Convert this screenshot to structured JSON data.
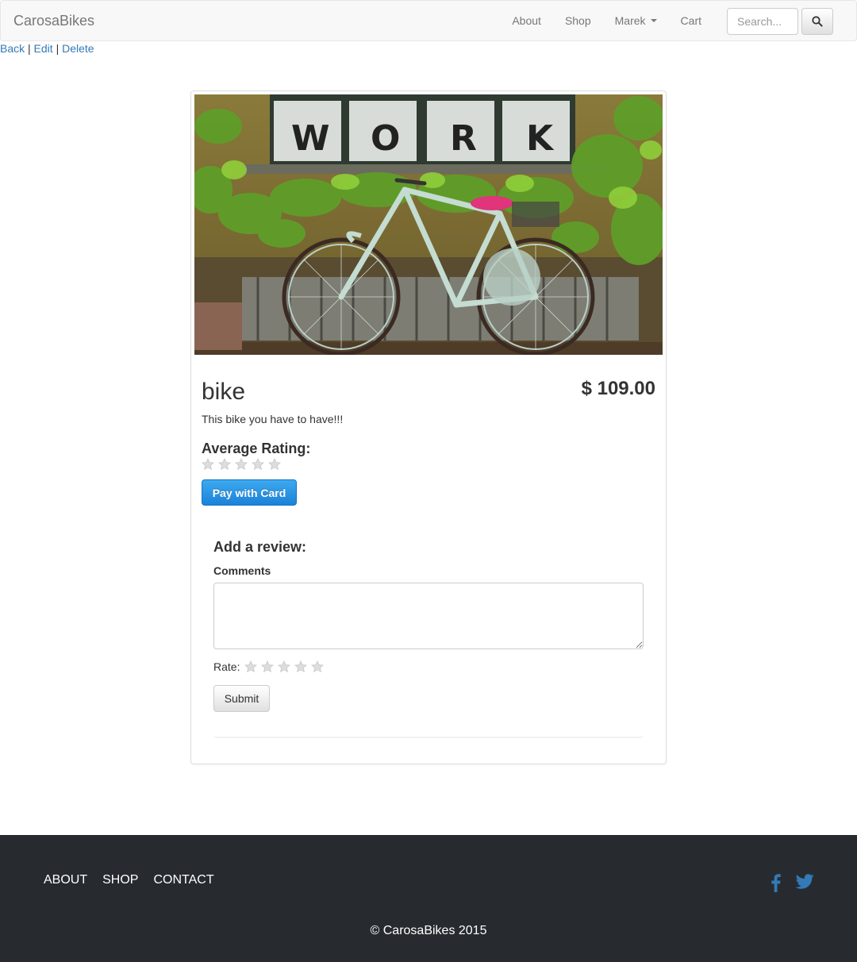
{
  "navbar": {
    "brand": "CarosaBikes",
    "links": {
      "about": "About",
      "shop": "Shop",
      "user": "Marek",
      "cart": "Cart"
    },
    "search_placeholder": "Search...",
    "search_icon": "search-icon"
  },
  "admin_links": {
    "back": "Back",
    "separator": "|",
    "edit": "Edit",
    "delete": "Delete"
  },
  "product": {
    "image_sign": "W O R K",
    "name": "bike",
    "price": "$ 109.00",
    "description": "This bike you have to have!!!",
    "average_rating_label": "Average Rating:",
    "average_rating": 0,
    "max_rating": 5,
    "pay_button": "Pay with Card"
  },
  "review_form": {
    "title": "Add a review:",
    "comments_label": "Comments",
    "comments_value": "",
    "rate_label": "Rate:",
    "rate_value": 0,
    "submit_label": "Submit"
  },
  "footer": {
    "links": {
      "about": "ABOUT",
      "shop": "SHOP",
      "contact": "CONTACT"
    },
    "social_icons": [
      "facebook-icon",
      "twitter-icon"
    ],
    "copyright": "© CarosaBikes 2015"
  },
  "colors": {
    "link": "#337ab7",
    "pay_button": "#1b82d8",
    "footer_bg": "#272b30",
    "social": "#337ab7",
    "star_empty": "#dddddd"
  }
}
